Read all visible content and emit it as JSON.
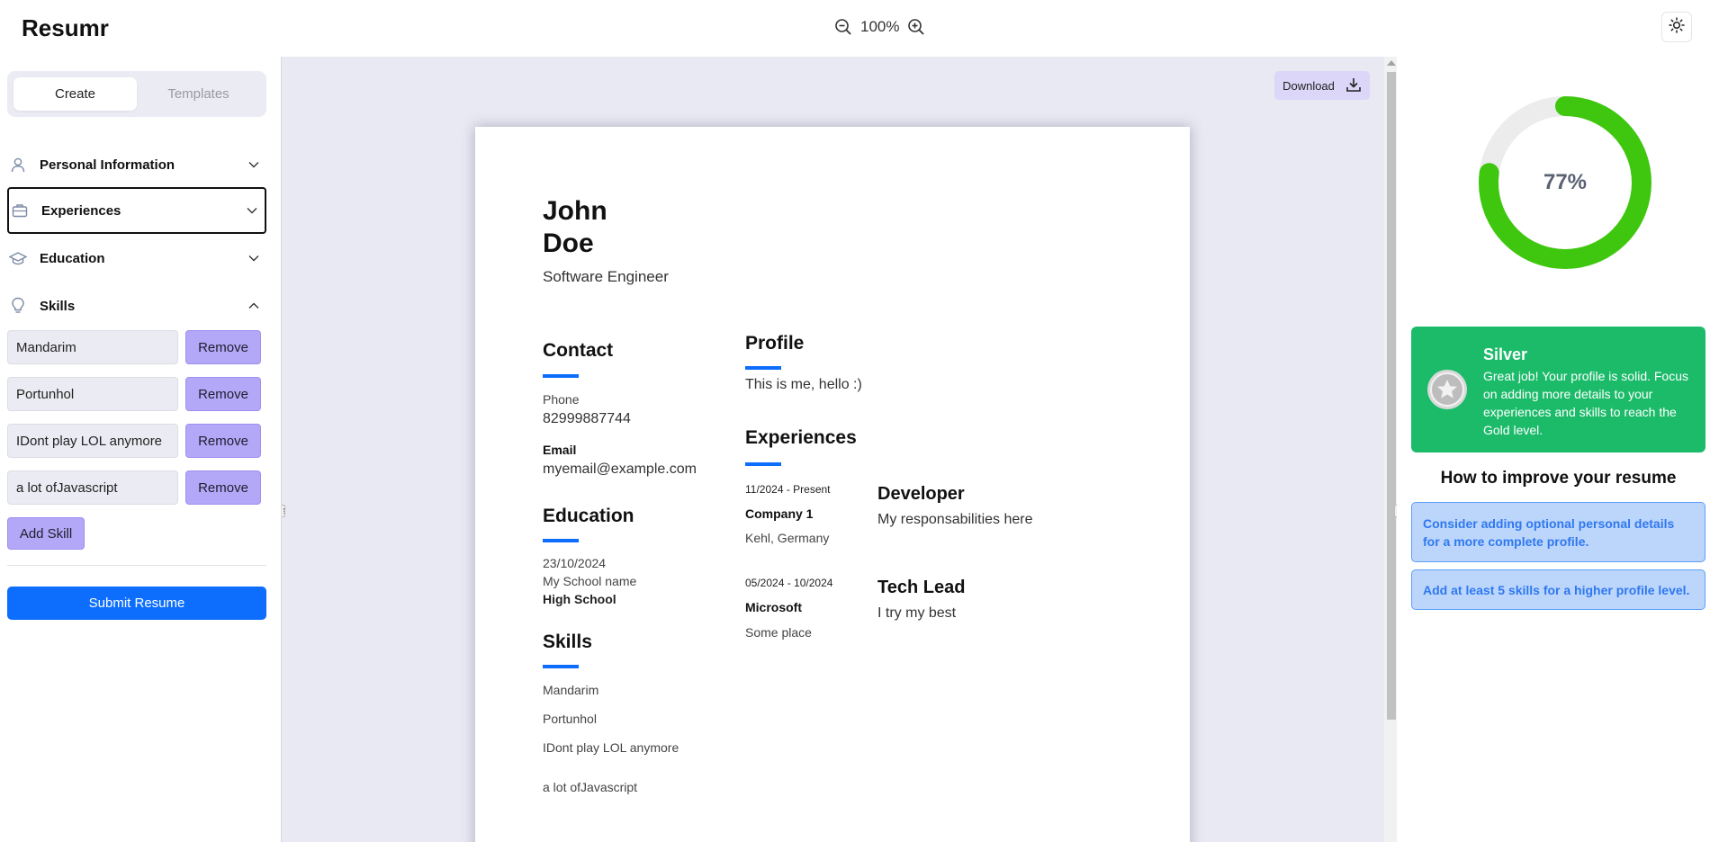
{
  "app": {
    "title": "Resumr"
  },
  "zoom": {
    "level": "100%"
  },
  "sidebar": {
    "tabs": [
      {
        "label": "Create",
        "active": true
      },
      {
        "label": "Templates",
        "active": false
      }
    ],
    "sections": [
      {
        "label": "Personal Information",
        "icon": "user-icon",
        "expanded": false
      },
      {
        "label": "Experiences",
        "icon": "briefcase-icon",
        "expanded": false
      },
      {
        "label": "Education",
        "icon": "graduation-cap-icon",
        "expanded": false
      },
      {
        "label": "Skills",
        "icon": "lightbulb-icon",
        "expanded": true
      }
    ],
    "skills": [
      {
        "value": "Mandarim",
        "remove_label": "Remove"
      },
      {
        "value": "Portunhol",
        "remove_label": "Remove"
      },
      {
        "value": "IDont play LOL anymore",
        "remove_label": "Remove"
      },
      {
        "value": "a lot ofJavascript",
        "remove_label": "Remove"
      }
    ],
    "add_skill_label": "Add Skill",
    "submit_label": "Submit Resume"
  },
  "preview": {
    "download_label": "Download",
    "resume": {
      "first_name": "John",
      "last_name": "Doe",
      "job_title": "Software Engineer",
      "contact_heading": "Contact",
      "phone_label": "Phone",
      "phone": "82999887744",
      "email_label": "Email",
      "email": "myemail@example.com",
      "education_heading": "Education",
      "education": {
        "date": "23/10/2024",
        "school": "My School name",
        "degree": "High School"
      },
      "skills_heading": "Skills",
      "skills": [
        "Mandarim",
        "Portunhol",
        "IDont play LOL anymore",
        "a lot ofJavascript"
      ],
      "profile_heading": "Profile",
      "profile_text": "This is me, hello :)",
      "experiences_heading": "Experiences",
      "experiences": [
        {
          "dates": "11/2024 - Present",
          "company": "Company 1",
          "location": "Kehl, Germany",
          "role": "Developer",
          "description": "My responsabilities here"
        },
        {
          "dates": "05/2024 - 10/2024",
          "company": "Microsoft",
          "location": "Some place",
          "role": "Tech Lead",
          "description": "I try my best"
        }
      ]
    }
  },
  "score": {
    "percent_label": "77%",
    "fraction": 0.77,
    "ring_color": "#3ec70e",
    "track_color": "#ececec"
  },
  "level": {
    "title": "Silver",
    "description": "Great job! Your profile is solid. Focus on adding more details to your experiences and skills to reach the Gold level.",
    "card_color": "#1cbb6a"
  },
  "improve": {
    "title": "How to improve your resume",
    "tips": [
      "Consider adding optional personal details for a more complete profile.",
      "Add at least 5 skills for a higher profile level."
    ]
  }
}
